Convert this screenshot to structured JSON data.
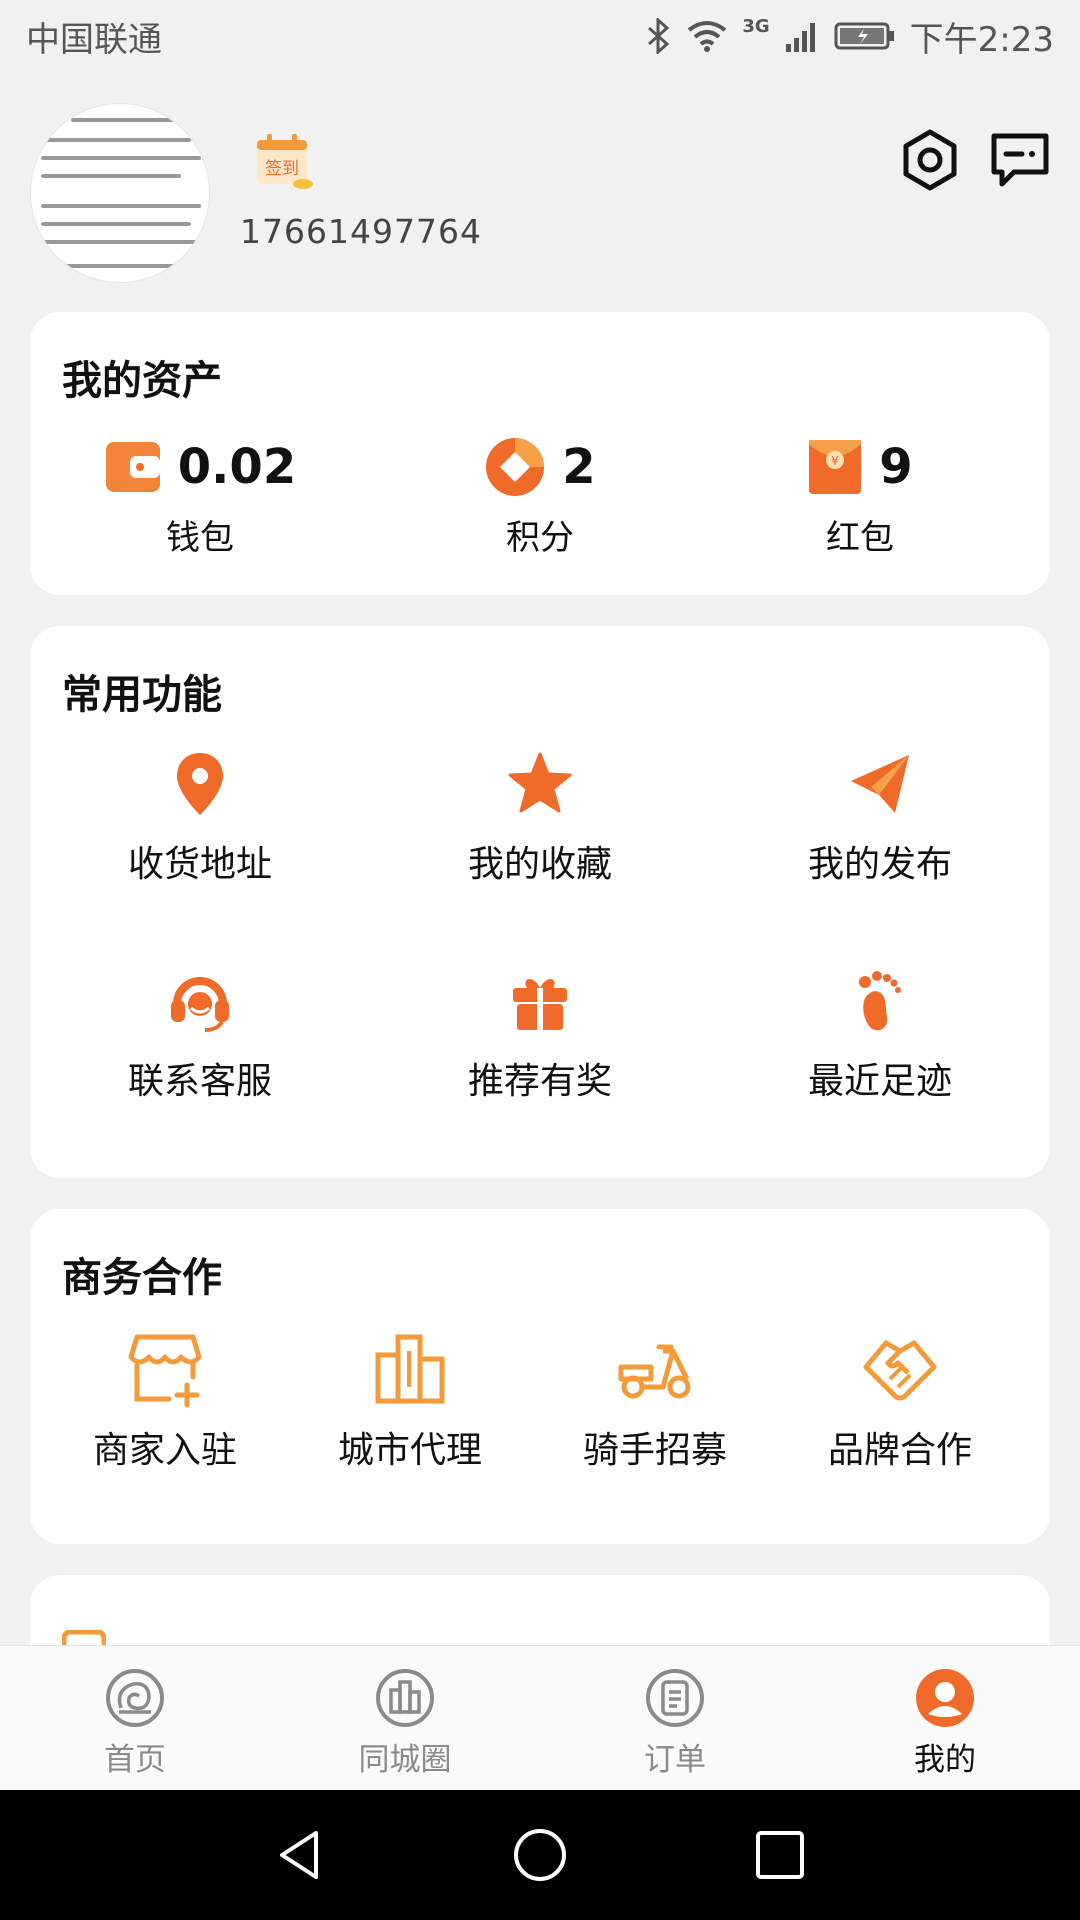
{
  "status_bar": {
    "carrier": "中国联通",
    "network": "3G",
    "time": "下午2:23"
  },
  "profile": {
    "phone": "17661497764",
    "sign_in_label": "签到",
    "avatar_icon": "document-thumbnail"
  },
  "top_actions": {
    "settings_icon": "settings-hex-icon",
    "message_icon": "message-icon"
  },
  "assets": {
    "title": "我的资产",
    "items": [
      {
        "icon": "wallet-icon",
        "value": "0.02",
        "label": "钱包"
      },
      {
        "icon": "points-icon",
        "value": "2",
        "label": "积分"
      },
      {
        "icon": "red-packet-icon",
        "value": "9",
        "label": "红包"
      }
    ]
  },
  "common_functions": {
    "title": "常用功能",
    "items": [
      {
        "icon": "location-icon",
        "label": "收货地址"
      },
      {
        "icon": "star-icon",
        "label": "我的收藏"
      },
      {
        "icon": "paper-plane-icon",
        "label": "我的发布"
      },
      {
        "icon": "headset-icon",
        "label": "联系客服"
      },
      {
        "icon": "gift-icon",
        "label": "推荐有奖"
      },
      {
        "icon": "footprint-icon",
        "label": "最近足迹"
      }
    ]
  },
  "business": {
    "title": "商务合作",
    "items": [
      {
        "icon": "store-icon",
        "label": "商家入驻"
      },
      {
        "icon": "city-icon",
        "label": "城市代理"
      },
      {
        "icon": "scooter-icon",
        "label": "骑手招募"
      },
      {
        "icon": "handshake-icon",
        "label": "品牌合作"
      }
    ]
  },
  "bottom_nav": {
    "items": [
      {
        "icon": "home-shell-icon",
        "label": "首页"
      },
      {
        "icon": "city-circle-icon",
        "label": "同城圈"
      },
      {
        "icon": "order-icon",
        "label": "订单"
      },
      {
        "icon": "profile-icon",
        "label": "我的",
        "active": true
      }
    ]
  },
  "colors": {
    "accent": "#f06a2a",
    "accent_light": "#f6a04a",
    "background": "#f1f1f1",
    "card": "#ffffff"
  }
}
